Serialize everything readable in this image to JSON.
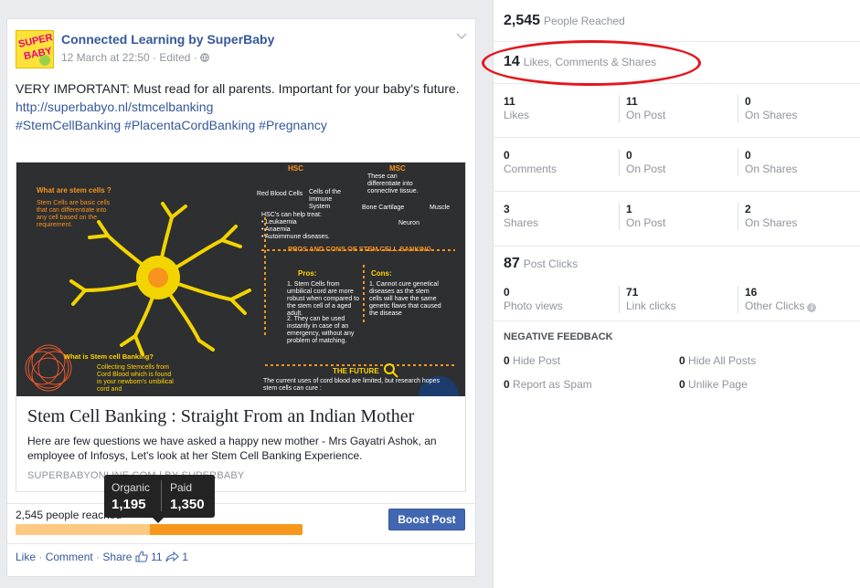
{
  "post": {
    "page_name": "Connected Learning by SuperBaby",
    "meta": "12 March at 22:50 · Edited · ",
    "avatar_text": [
      "SUPER",
      "BABY"
    ],
    "text": "VERY IMPORTANT: Must read for all parents. Important for your baby's future.",
    "link_url": "http://superbabyo.nl/stmcelbanking",
    "hashtags": "#StemCellBanking #PlacentaCordBanking #Pregnancy",
    "link": {
      "title": "Stem Cell Banking : Straight From an Indian Mother",
      "description": "Here are few questions we have asked a happy new mother - Mrs Gayatri Ashok, an employee of Infosys, Let's look at her Stem Cell Banking Experience.",
      "domain": "SUPERBABYONLINE.COM | BY SUPERBABY"
    },
    "infographic": {
      "what_are": "What are stem cells ?",
      "what_are_desc": "Stem Cells are basic cells that can differentiate into any cell based on the requirement.",
      "hsc": "HSC",
      "msc": "MSC",
      "msc_desc": "These can differentiate into connective tissue.",
      "hsc_rbc": "Red Blood Cells",
      "hsc_immune": "Cells of the Immune System",
      "hsc_treat": "HSC's can help treat:\n• Leukaemia\n• Anaemia\n• Autoimmune diseases.",
      "msc_bone": "Bone Cartilage",
      "msc_muscle": "Muscle",
      "msc_neuron": "Neuron",
      "pros_cons": "PROS AND CONS OF STEM CELL BANKING",
      "pros": "Pros:",
      "pros_1": "1. Stem Cells from umbilical cord are more robust when compared to the stem cell of a aged adult.",
      "pros_2": "2. They can be used instantly in case of an emergency, without any problem of matching.",
      "cons": "Cons:",
      "cons_1": "1. Cannot cure genetical diseases as the stem cells will have the same genetic flaws that caused the disease",
      "what_is": "What is Stem cell Banking?",
      "what_is_desc": "Collecting Stemcells from Cord Blood which is found in your newborn's umbilical cord and",
      "future": "THE FUTURE",
      "future_desc": "The current uses of cord blood are limited, but research hopes stem cells can cure :"
    },
    "reach": {
      "label": "2,545 people reached",
      "organic_label": "Organic",
      "organic_value": "1,195",
      "paid_label": "Paid",
      "paid_value": "1,350",
      "organic_fraction": 0.4695,
      "boost_label": "Boost Post"
    },
    "actions": {
      "like": "Like",
      "comment": "Comment",
      "share": "Share",
      "like_count": "11",
      "share_count": "1"
    }
  },
  "insights": {
    "people_reached": {
      "value": "2,545",
      "label": "People Reached"
    },
    "engagement": {
      "value": "14",
      "label": "Likes, Comments & Shares"
    },
    "grid": [
      [
        {
          "n": "11",
          "t": "Likes"
        },
        {
          "n": "11",
          "t": "On Post"
        },
        {
          "n": "0",
          "t": "On Shares"
        }
      ],
      [
        {
          "n": "0",
          "t": "Comments"
        },
        {
          "n": "0",
          "t": "On Post"
        },
        {
          "n": "0",
          "t": "On Shares"
        }
      ],
      [
        {
          "n": "3",
          "t": "Shares"
        },
        {
          "n": "1",
          "t": "On Post"
        },
        {
          "n": "2",
          "t": "On Shares"
        }
      ]
    ],
    "post_clicks": {
      "value": "87",
      "label": "Post Clicks"
    },
    "clicks": [
      {
        "n": "0",
        "t": "Photo views"
      },
      {
        "n": "71",
        "t": "Link clicks"
      },
      {
        "n": "16",
        "t": "Other Clicks"
      }
    ],
    "negative": {
      "title": "NEGATIVE FEEDBACK",
      "items": [
        {
          "n": "0",
          "t": "Hide Post"
        },
        {
          "n": "0",
          "t": "Hide All Posts"
        },
        {
          "n": "0",
          "t": "Report as Spam"
        },
        {
          "n": "0",
          "t": "Unlike Page"
        }
      ]
    }
  },
  "colors": {
    "link": "#365899",
    "boost": "#4267b2",
    "organic": "#fcc982",
    "paid": "#f7981d",
    "highlight_circle": "#e3171e"
  }
}
